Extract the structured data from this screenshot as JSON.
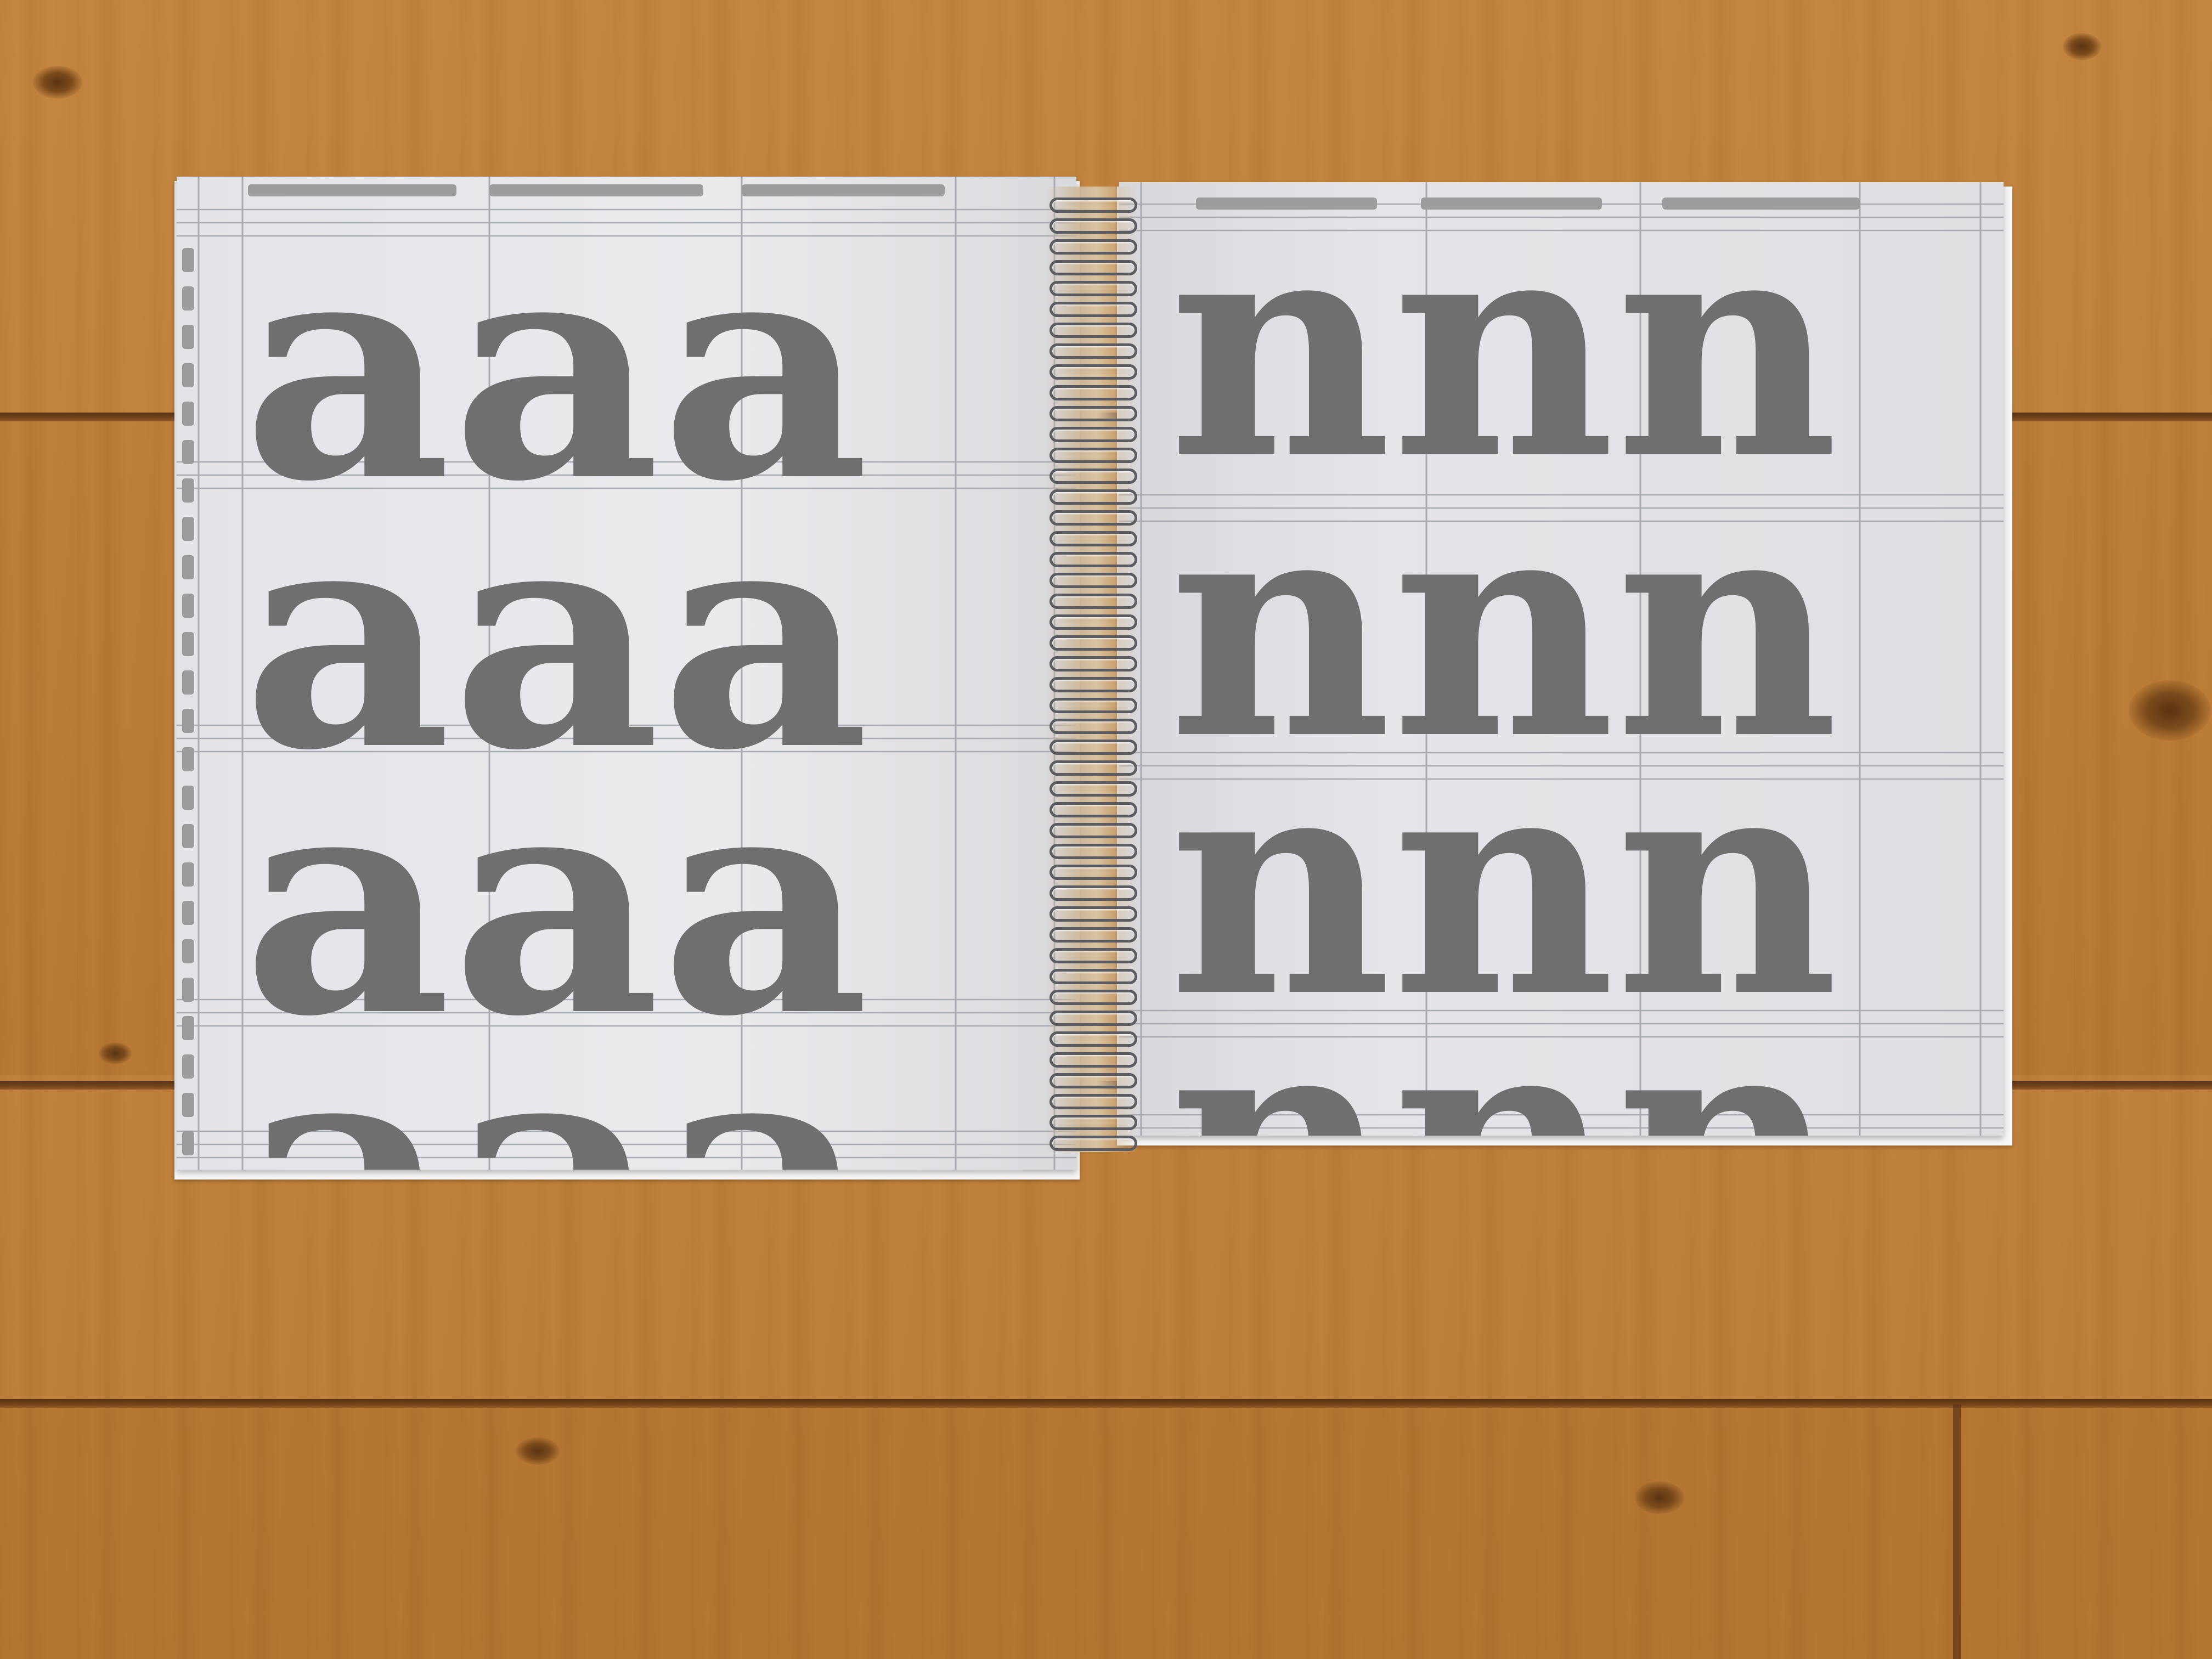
{
  "scene": {
    "description_free": true,
    "surface_color": "#b97a35",
    "page_color": "#e7e7ea",
    "ink_color": "#6f6f70"
  },
  "left_page": {
    "rows": [
      "aaa",
      "aaa",
      "aaa",
      "aaa"
    ]
  },
  "right_page": {
    "rows": [
      "nnn",
      "nnn",
      "nnn",
      "nnn"
    ]
  }
}
